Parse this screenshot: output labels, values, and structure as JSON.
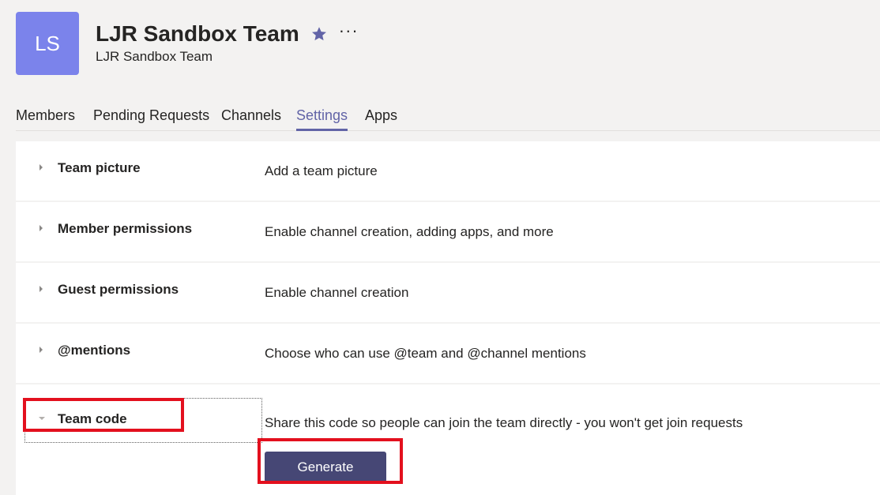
{
  "team": {
    "initials": "LS",
    "name": "LJR Sandbox Team",
    "subtitle": "LJR Sandbox Team",
    "avatar_color": "#7b83eb",
    "star_icon": "star-icon",
    "more_icon": "more-options-icon",
    "more_glyph": "···"
  },
  "tabs": [
    {
      "label": "Members",
      "active": false
    },
    {
      "label": "Pending Requests",
      "active": false
    },
    {
      "label": "Channels",
      "active": false
    },
    {
      "label": "Settings",
      "active": true
    },
    {
      "label": "Apps",
      "active": false
    }
  ],
  "settings": [
    {
      "label": "Team picture",
      "description": "Add a team picture",
      "expanded": false
    },
    {
      "label": "Member permissions",
      "description": "Enable channel creation, adding apps, and more",
      "expanded": false
    },
    {
      "label": "Guest permissions",
      "description": "Enable channel creation",
      "expanded": false
    },
    {
      "label": "@mentions",
      "description": "Choose who can use @team and @channel mentions",
      "expanded": false
    },
    {
      "label": "Team code",
      "description": "Share this code so people can join the team directly - you won't get join requests",
      "expanded": true
    }
  ],
  "team_code": {
    "button_label": "Generate"
  },
  "colors": {
    "accent": "#6264a7",
    "button": "#464775",
    "highlight": "#e3101e",
    "background": "#f3f2f1"
  }
}
